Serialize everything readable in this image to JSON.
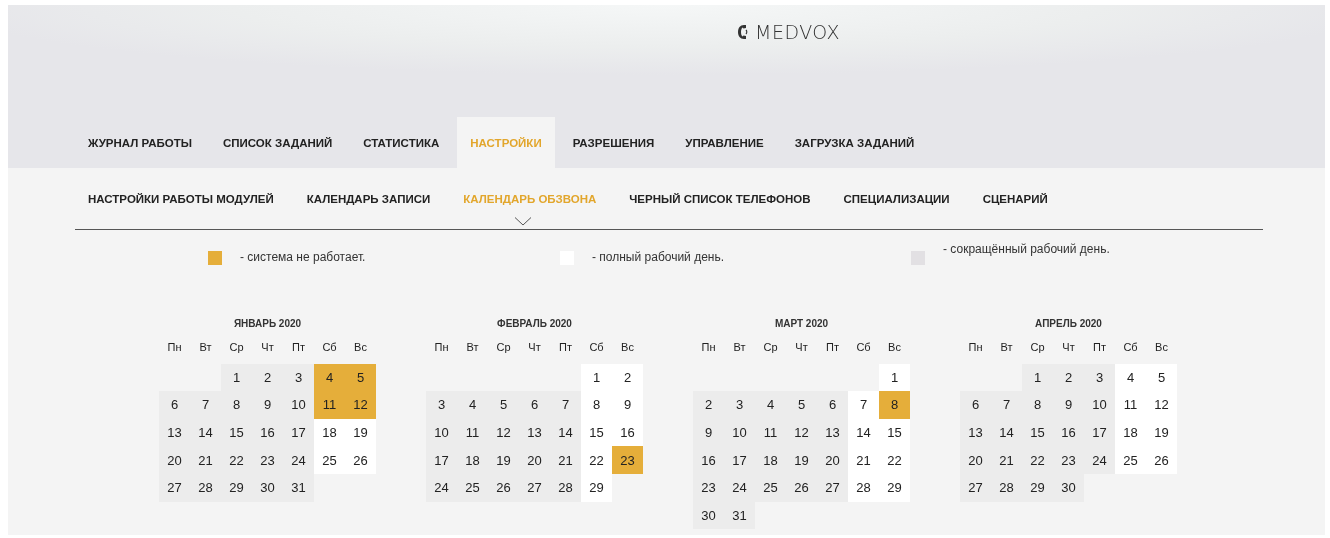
{
  "logo": {
    "text": "MEDVOX"
  },
  "tabs": [
    {
      "label": "ЖУРНАЛ РАБОТЫ",
      "selected": false
    },
    {
      "label": "СПИСОК ЗАДАНИЙ",
      "selected": false
    },
    {
      "label": "СТАТИСТИКА",
      "selected": false
    },
    {
      "label": "НАСТРОЙКИ",
      "selected": true
    },
    {
      "label": "РАЗРЕШЕНИЯ",
      "selected": false
    },
    {
      "label": "УПРАВЛЕНИЕ",
      "selected": false
    },
    {
      "label": "ЗАГРУЗКА ЗАДАНИЙ",
      "selected": false
    }
  ],
  "subtabs": [
    {
      "label": "НАСТРОЙКИ РАБОТЫ МОДУЛЕЙ",
      "selected": false
    },
    {
      "label": "КАЛЕНДАРЬ ЗАПИСИ",
      "selected": false
    },
    {
      "label": "КАЛЕНДАРЬ ОБЗВОНА",
      "selected": true
    },
    {
      "label": "ЧЕРНЫЙ СПИСОК ТЕЛЕФОНОВ",
      "selected": false
    },
    {
      "label": "СПЕЦИАЛИЗАЦИИ",
      "selected": false
    },
    {
      "label": "СЦЕНАРИЙ",
      "selected": false
    }
  ],
  "legend": [
    {
      "kind": "off",
      "text": "- система не работает."
    },
    {
      "kind": "full",
      "text": "- полный рабочий день."
    },
    {
      "kind": "short",
      "text": "- сокращённый рабочий день."
    }
  ],
  "months": [
    {
      "title": "ЯНВАРЬ 2020",
      "weekdays": [
        "Пн",
        "Вт",
        "Ср",
        "Чт",
        "Пт",
        "Сб",
        "Вс"
      ],
      "days": [
        {
          "kind": "blank"
        },
        {
          "kind": "blank"
        },
        {
          "d": "1",
          "kind": "work"
        },
        {
          "d": "2",
          "kind": "work"
        },
        {
          "d": "3",
          "kind": "work"
        },
        {
          "d": "4",
          "kind": "off"
        },
        {
          "d": "5",
          "kind": "off"
        },
        {
          "d": "6",
          "kind": "work"
        },
        {
          "d": "7",
          "kind": "work"
        },
        {
          "d": "8",
          "kind": "work"
        },
        {
          "d": "9",
          "kind": "work"
        },
        {
          "d": "10",
          "kind": "work"
        },
        {
          "d": "11",
          "kind": "off"
        },
        {
          "d": "12",
          "kind": "off"
        },
        {
          "d": "13",
          "kind": "work"
        },
        {
          "d": "14",
          "kind": "work"
        },
        {
          "d": "15",
          "kind": "work"
        },
        {
          "d": "16",
          "kind": "work"
        },
        {
          "d": "17",
          "kind": "work"
        },
        {
          "d": "18",
          "kind": "full"
        },
        {
          "d": "19",
          "kind": "full"
        },
        {
          "d": "20",
          "kind": "work"
        },
        {
          "d": "21",
          "kind": "work"
        },
        {
          "d": "22",
          "kind": "work"
        },
        {
          "d": "23",
          "kind": "work"
        },
        {
          "d": "24",
          "kind": "work"
        },
        {
          "d": "25",
          "kind": "full"
        },
        {
          "d": "26",
          "kind": "full"
        },
        {
          "d": "27",
          "kind": "work"
        },
        {
          "d": "28",
          "kind": "work"
        },
        {
          "d": "29",
          "kind": "work"
        },
        {
          "d": "30",
          "kind": "work"
        },
        {
          "d": "31",
          "kind": "work"
        }
      ]
    },
    {
      "title": "ФЕВРАЛЬ 2020",
      "weekdays": [
        "Пн",
        "Вт",
        "Ср",
        "Чт",
        "Пт",
        "Сб",
        "Вс"
      ],
      "days": [
        {
          "kind": "blank"
        },
        {
          "kind": "blank"
        },
        {
          "kind": "blank"
        },
        {
          "kind": "blank"
        },
        {
          "kind": "blank"
        },
        {
          "d": "1",
          "kind": "full"
        },
        {
          "d": "2",
          "kind": "full"
        },
        {
          "d": "3",
          "kind": "work"
        },
        {
          "d": "4",
          "kind": "work"
        },
        {
          "d": "5",
          "kind": "work"
        },
        {
          "d": "6",
          "kind": "work"
        },
        {
          "d": "7",
          "kind": "work"
        },
        {
          "d": "8",
          "kind": "full"
        },
        {
          "d": "9",
          "kind": "full"
        },
        {
          "d": "10",
          "kind": "work"
        },
        {
          "d": "11",
          "kind": "work"
        },
        {
          "d": "12",
          "kind": "work"
        },
        {
          "d": "13",
          "kind": "work"
        },
        {
          "d": "14",
          "kind": "work"
        },
        {
          "d": "15",
          "kind": "full"
        },
        {
          "d": "16",
          "kind": "full"
        },
        {
          "d": "17",
          "kind": "work"
        },
        {
          "d": "18",
          "kind": "work"
        },
        {
          "d": "19",
          "kind": "work"
        },
        {
          "d": "20",
          "kind": "work"
        },
        {
          "d": "21",
          "kind": "work"
        },
        {
          "d": "22",
          "kind": "full"
        },
        {
          "d": "23",
          "kind": "off"
        },
        {
          "d": "24",
          "kind": "work"
        },
        {
          "d": "25",
          "kind": "work"
        },
        {
          "d": "26",
          "kind": "work"
        },
        {
          "d": "27",
          "kind": "work"
        },
        {
          "d": "28",
          "kind": "work"
        },
        {
          "d": "29",
          "kind": "full"
        }
      ]
    },
    {
      "title": "МАРТ 2020",
      "weekdays": [
        "Пн",
        "Вт",
        "Ср",
        "Чт",
        "Пт",
        "Сб",
        "Вс"
      ],
      "days": [
        {
          "kind": "blank"
        },
        {
          "kind": "blank"
        },
        {
          "kind": "blank"
        },
        {
          "kind": "blank"
        },
        {
          "kind": "blank"
        },
        {
          "kind": "blank"
        },
        {
          "d": "1",
          "kind": "full"
        },
        {
          "d": "2",
          "kind": "work"
        },
        {
          "d": "3",
          "kind": "work"
        },
        {
          "d": "4",
          "kind": "work"
        },
        {
          "d": "5",
          "kind": "work"
        },
        {
          "d": "6",
          "kind": "work"
        },
        {
          "d": "7",
          "kind": "full"
        },
        {
          "d": "8",
          "kind": "off"
        },
        {
          "d": "9",
          "kind": "work"
        },
        {
          "d": "10",
          "kind": "work"
        },
        {
          "d": "11",
          "kind": "work"
        },
        {
          "d": "12",
          "kind": "work"
        },
        {
          "d": "13",
          "kind": "work"
        },
        {
          "d": "14",
          "kind": "full"
        },
        {
          "d": "15",
          "kind": "full"
        },
        {
          "d": "16",
          "kind": "work"
        },
        {
          "d": "17",
          "kind": "work"
        },
        {
          "d": "18",
          "kind": "work"
        },
        {
          "d": "19",
          "kind": "work"
        },
        {
          "d": "20",
          "kind": "work"
        },
        {
          "d": "21",
          "kind": "full"
        },
        {
          "d": "22",
          "kind": "full"
        },
        {
          "d": "23",
          "kind": "work"
        },
        {
          "d": "24",
          "kind": "work"
        },
        {
          "d": "25",
          "kind": "work"
        },
        {
          "d": "26",
          "kind": "work"
        },
        {
          "d": "27",
          "kind": "work"
        },
        {
          "d": "28",
          "kind": "full"
        },
        {
          "d": "29",
          "kind": "full"
        },
        {
          "d": "30",
          "kind": "work"
        },
        {
          "d": "31",
          "kind": "work"
        }
      ]
    },
    {
      "title": "АПРЕЛЬ 2020",
      "weekdays": [
        "Пн",
        "Вт",
        "Ср",
        "Чт",
        "Пт",
        "Сб",
        "Вс"
      ],
      "days": [
        {
          "kind": "blank"
        },
        {
          "kind": "blank"
        },
        {
          "d": "1",
          "kind": "work"
        },
        {
          "d": "2",
          "kind": "work"
        },
        {
          "d": "3",
          "kind": "work"
        },
        {
          "d": "4",
          "kind": "full"
        },
        {
          "d": "5",
          "kind": "full"
        },
        {
          "d": "6",
          "kind": "work"
        },
        {
          "d": "7",
          "kind": "work"
        },
        {
          "d": "8",
          "kind": "work"
        },
        {
          "d": "9",
          "kind": "work"
        },
        {
          "d": "10",
          "kind": "work"
        },
        {
          "d": "11",
          "kind": "full"
        },
        {
          "d": "12",
          "kind": "full"
        },
        {
          "d": "13",
          "kind": "work"
        },
        {
          "d": "14",
          "kind": "work"
        },
        {
          "d": "15",
          "kind": "work"
        },
        {
          "d": "16",
          "kind": "work"
        },
        {
          "d": "17",
          "kind": "work"
        },
        {
          "d": "18",
          "kind": "full"
        },
        {
          "d": "19",
          "kind": "full"
        },
        {
          "d": "20",
          "kind": "work"
        },
        {
          "d": "21",
          "kind": "work"
        },
        {
          "d": "22",
          "kind": "work"
        },
        {
          "d": "23",
          "kind": "work"
        },
        {
          "d": "24",
          "kind": "work"
        },
        {
          "d": "25",
          "kind": "full"
        },
        {
          "d": "26",
          "kind": "full"
        },
        {
          "d": "27",
          "kind": "work"
        },
        {
          "d": "28",
          "kind": "work"
        },
        {
          "d": "29",
          "kind": "work"
        },
        {
          "d": "30",
          "kind": "work"
        }
      ]
    }
  ]
}
